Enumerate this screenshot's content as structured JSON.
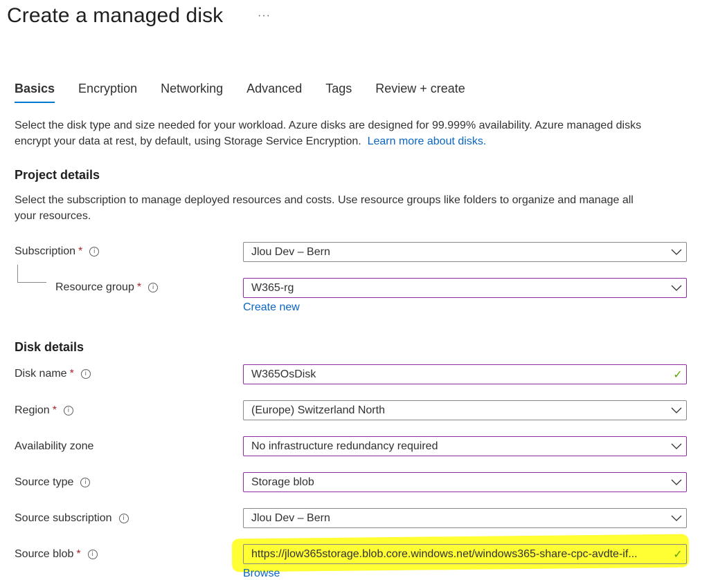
{
  "page": {
    "title": "Create a managed disk",
    "more": "···"
  },
  "tabs": [
    {
      "label": "Basics",
      "active": true
    },
    {
      "label": "Encryption"
    },
    {
      "label": "Networking"
    },
    {
      "label": "Advanced"
    },
    {
      "label": "Tags"
    },
    {
      "label": "Review + create"
    }
  ],
  "intro": {
    "line1": "Select the disk type and size needed for your workload. Azure disks are designed for 99.999% availability. Azure managed disks",
    "line2": "encrypt your data at rest, by default, using Storage Service Encryption.",
    "link": "Learn more about disks."
  },
  "project": {
    "heading": "Project details",
    "desc_line1": "Select the subscription to manage deployed resources and costs. Use resource groups like folders to organize and manage all",
    "desc_line2": "your resources."
  },
  "fields": {
    "subscription": {
      "label": "Subscription",
      "value": "Jlou Dev – Bern"
    },
    "resource_group": {
      "label": "Resource group",
      "value": "W365-rg",
      "create_new": "Create new"
    },
    "disk_name": {
      "label": "Disk name",
      "value": "W365OsDisk"
    },
    "region": {
      "label": "Region",
      "value": "(Europe) Switzerland North"
    },
    "availability_zone": {
      "label": "Availability zone",
      "value": "No infrastructure redundancy required"
    },
    "source_type": {
      "label": "Source type",
      "value": "Storage blob"
    },
    "source_subscription": {
      "label": "Source subscription",
      "value": "Jlou Dev – Bern"
    },
    "source_blob": {
      "label": "Source blob",
      "value": "https://jlow365storage.blob.core.windows.net/windows365-share-cpc-avdte-if...",
      "browse": "Browse"
    }
  },
  "disk": {
    "heading": "Disk details"
  },
  "symbols": {
    "required": "*",
    "info": "i",
    "check": "✓"
  },
  "colors": {
    "accent": "#0078d4",
    "link": "#0a66c2",
    "required": "#a4262c",
    "highlight": "#ffff33",
    "valid": "#57a300"
  }
}
